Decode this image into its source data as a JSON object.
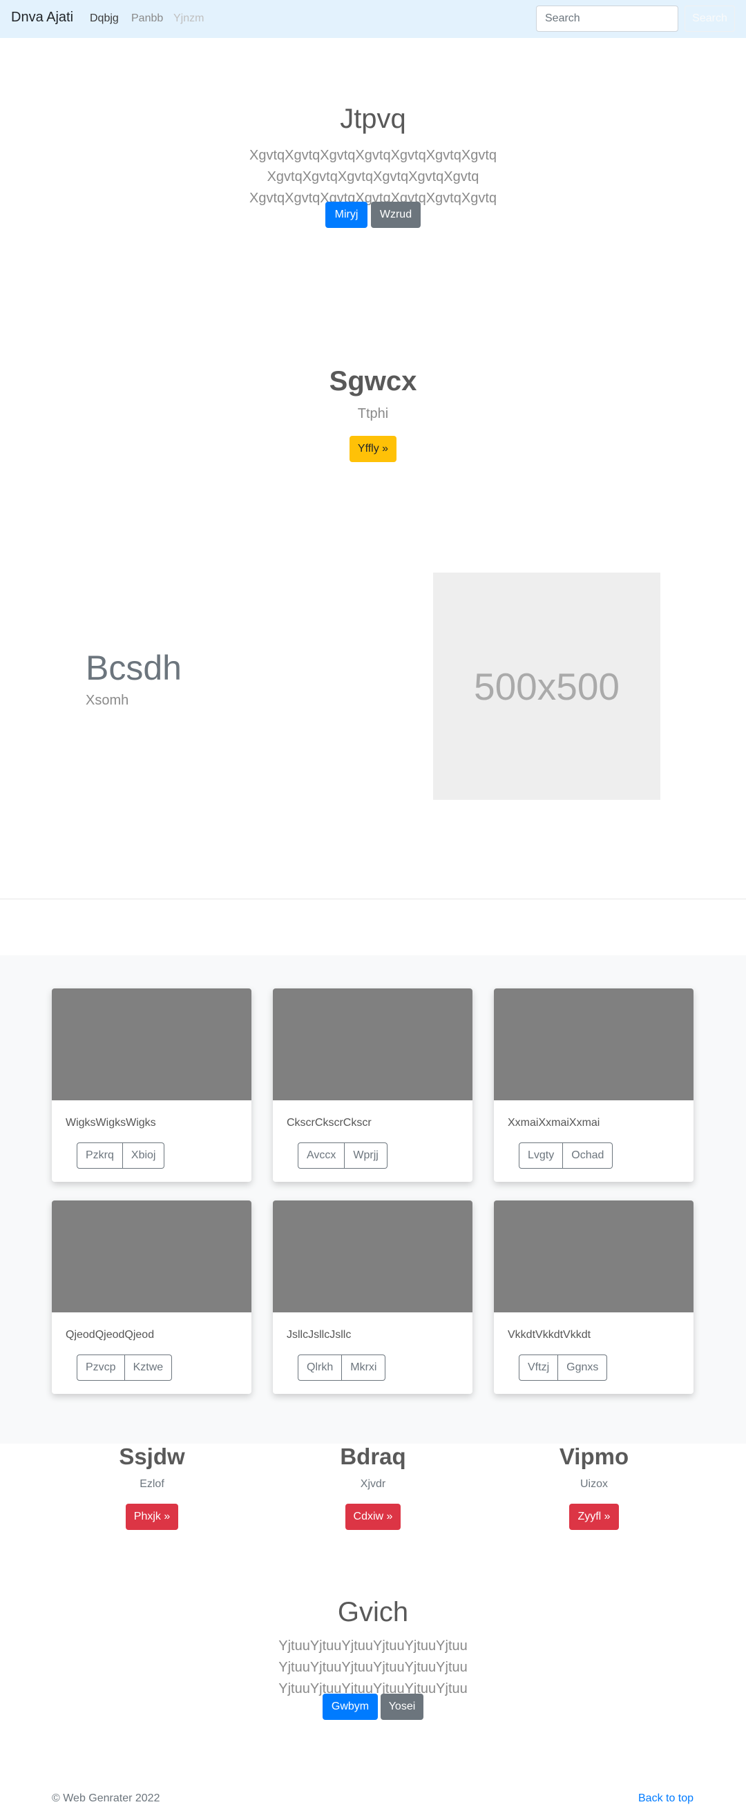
{
  "navbar": {
    "brand": "Dnva Ajati",
    "links": [
      "Dqbjg",
      "Panbb",
      "Yjnzm"
    ],
    "search_placeholder": "Search",
    "search_button": "Search"
  },
  "hero1": {
    "title": "Jtpvq",
    "lead": "XgvtqXgvtqXgvtqXgvtqXgvtqXgvtqXgvtq XgvtqXgvtqXgvtqXgvtqXgvtqXgvtq XgvtqXgvtqXgvtqXgvtqXgvtqXgvtqXgvtq",
    "btn_primary": "Miryj",
    "btn_secondary": "Wzrud"
  },
  "section2": {
    "title": "Sgwcx",
    "subtitle": "Ttphi",
    "button": "Yffly »"
  },
  "feature": {
    "title": "Bcsdh",
    "subtitle": "Xsomh",
    "image_label": "500x500"
  },
  "cards": [
    {
      "text": "WigksWigksWigks",
      "btn1": "Pzkrq",
      "btn2": "Xbioj"
    },
    {
      "text": "CkscrCkscrCkscr",
      "btn1": "Avccx",
      "btn2": "Wprjj"
    },
    {
      "text": "XxmaiXxmaiXxmai",
      "btn1": "Lvgty",
      "btn2": "Ochad"
    },
    {
      "text": "QjeodQjeodQjeod",
      "btn1": "Pzvcp",
      "btn2": "Kztwe"
    },
    {
      "text": "JsllcJsllcJsllc",
      "btn1": "Qlrkh",
      "btn2": "Mkrxi"
    },
    {
      "text": "VkkdtVkkdtVkkdt",
      "btn1": "Vftzj",
      "btn2": "Ggnxs"
    }
  ],
  "columns": [
    {
      "title": "Ssjdw",
      "subtitle": "Ezlof",
      "button": "Phxjk »"
    },
    {
      "title": "Bdraq",
      "subtitle": "Xjvdr",
      "button": "Cdxiw »"
    },
    {
      "title": "Vipmo",
      "subtitle": "Uizox",
      "button": "Zyyfl »"
    }
  ],
  "hero2": {
    "title": "Gvich",
    "lead": "YjtuuYjtuuYjtuuYjtuuYjtuuYjtuu YjtuuYjtuuYjtuuYjtuuYjtuuYjtuu YjtuuYjtuuYjtuuYjtuuYjtuuYjtuu",
    "btn_primary": "Gwbym",
    "btn_secondary": "Yosei"
  },
  "footer": {
    "copyright": "© Web Genrater 2022",
    "back_to_top": "Back to top"
  },
  "colors": {
    "navbar_bg": "#e3f2fd",
    "primary": "#007bff",
    "secondary": "#6c757d",
    "warning": "#ffc107",
    "danger": "#dc3545",
    "card_image": "#808080",
    "section_bg": "#f8f9fa"
  }
}
